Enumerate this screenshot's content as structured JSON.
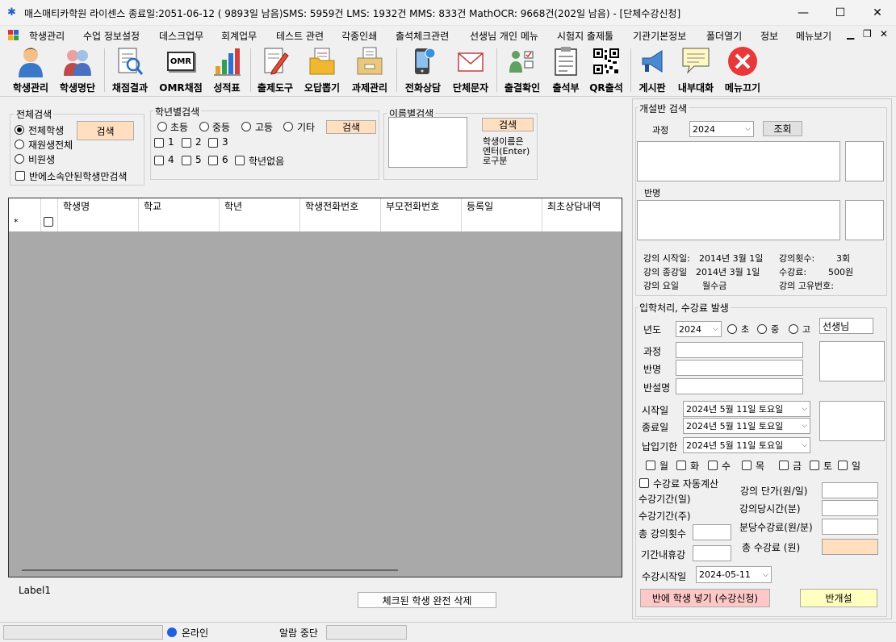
{
  "window": {
    "title": "매스매티카학원  라이센스 종료일:2051-06-12 ( 9893일 남음)SMS: 5959건 LMS: 1932건 MMS: 833건  MathOCR: 9668건(202일 남음) - [단체수강신청]",
    "minimize": "—",
    "maximize": "☐",
    "close": "✕"
  },
  "menu": {
    "items": [
      "학생관리",
      "수업 정보설정",
      "데스크업무",
      "회계업무",
      "테스트 관련",
      "각종인쇄",
      "출석체크관련",
      "선생님 개인 메뉴",
      "시험지 출제툴",
      "기관기본정보",
      "폴더열기",
      "정보",
      "메뉴보기"
    ],
    "mdi_min": "▁",
    "mdi_restore": "❐",
    "mdi_close": "✕"
  },
  "toolbar": {
    "items": [
      "학생관리",
      "학생명단",
      "채점결과",
      "OMR채점",
      "성적표",
      "출제도구",
      "오답뽑기",
      "과제관리",
      "전화상담",
      "단체문자",
      "출결확인",
      "출석부",
      "QR출석",
      "게시판",
      "내부대화",
      "메뉴끄기"
    ],
    "omr_icon_text": "OMR"
  },
  "search_all": {
    "title": "전체검색",
    "options": [
      "전체학생",
      "재원생전체",
      "비원생"
    ],
    "selected": "전체학생",
    "search_button": "검색",
    "unassigned_checkbox": "반에소속안된학생만검색"
  },
  "search_grade": {
    "title": "학년별검색",
    "levels": [
      "초등",
      "중등",
      "고등",
      "기타"
    ],
    "search_button": "검색",
    "grades": [
      "1",
      "2",
      "3",
      "4",
      "5",
      "6"
    ],
    "no_grade": "학년없음"
  },
  "search_name": {
    "title": "이름별검색",
    "search_button": "검색",
    "hint": [
      "학생이름은",
      "엔터(Enter)",
      "로구분"
    ]
  },
  "grid": {
    "columns": [
      "학생명",
      "학교",
      "학년",
      "학생전화번호",
      "부모전화번호",
      "등록일",
      "최초상담내역"
    ],
    "new_row_marker": "*"
  },
  "label1": "Label1",
  "delete_checked_button": "체크된 학생 완전 삭제",
  "class_search": {
    "title": "개설반 검색",
    "course_label": "과정",
    "course_value": "2024",
    "lookup_button": "조회",
    "class_name_label": "반명",
    "info": {
      "start_label": "강의 시작일:",
      "start_value": "2014년 3월 1일",
      "count_label": "강의횟수:",
      "count_value": "3회",
      "end_label": "강의 종강일",
      "end_value": "2014년 3월 1일",
      "fee_label": "수강료:",
      "fee_value": "500원",
      "days_label": "강의 요일",
      "days_value": "월수금",
      "id_label": "강의 고유번호:",
      "id_value": ""
    }
  },
  "enroll": {
    "title": "입학처리, 수강료 발생",
    "year_label": "년도",
    "year_value": "2024",
    "levels": [
      "초",
      "중",
      "고"
    ],
    "teacher_value": "선생님",
    "course_label": "과정",
    "class_label": "반명",
    "class_desc_label": "반설명",
    "start_label": "시작일",
    "end_label": "종료일",
    "due_label": "납입기한",
    "date_value": "2024년   5월 11일 토요일",
    "weekdays": [
      "월",
      "화",
      "수",
      "목",
      "금",
      "토",
      "일"
    ],
    "auto_calc": "수강료 자동계산",
    "period_days": "수강기간(일)",
    "period_weeks": "수강기간(주)",
    "total_lessons": "총 강의횟수",
    "holidays": "기간내휴강",
    "unit_price": "강의 단가(원/일)",
    "hours_per_lesson": "강의당시간(분)",
    "fee_per_minute": "분당수강료(원/분)",
    "total_fee": "총 수강료 (원)",
    "enroll_start_label": "수강시작일",
    "enroll_start_value": "2024-05-11",
    "add_button": "반에 학생 넣기 (수강신청)",
    "open_class_button": "반개설"
  },
  "status": {
    "online": "온라인",
    "alarm": "알람 중단"
  },
  "colors": {
    "peach": "#ffdfc0",
    "pink": "#ffc8c8",
    "yellow": "#ffffc0",
    "online": "#2060e0"
  }
}
